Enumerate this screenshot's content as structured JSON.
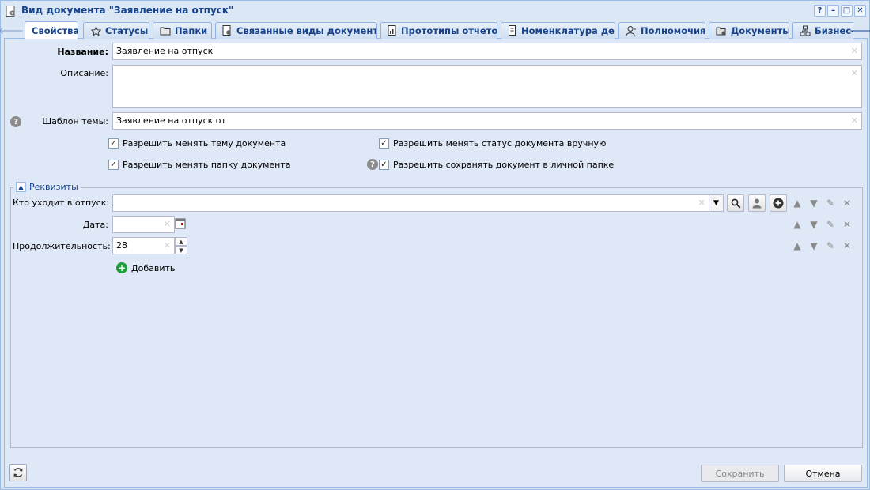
{
  "window": {
    "title": "Вид документа \"Заявление на отпуск\"",
    "buttons": {
      "help": "?",
      "minimize": "–",
      "maximize": "□",
      "close": "✕"
    }
  },
  "tabs": [
    {
      "label": "Свойства",
      "icon": "none",
      "active": true
    },
    {
      "label": "Статусы",
      "icon": "star-icon"
    },
    {
      "label": "Папки",
      "icon": "folder-icon"
    },
    {
      "label": "Связанные виды документов",
      "icon": "linked-doc-icon"
    },
    {
      "label": "Прототипы отчетов",
      "icon": "report-icon"
    },
    {
      "label": "Номенклатура дел",
      "icon": "nomenclature-icon"
    },
    {
      "label": "Полномочия",
      "icon": "user-permission-icon"
    },
    {
      "label": "Документы",
      "icon": "documents-icon"
    },
    {
      "label": "Бизнес-",
      "icon": "process-icon"
    }
  ],
  "form": {
    "name_label": "Название:",
    "name_value": "Заявление на отпуск",
    "description_label": "Описание:",
    "description_value": "",
    "template_label": "Шаблон темы:",
    "template_value": "Заявление на отпуск от",
    "help_glyph": "?"
  },
  "checkboxes": {
    "allow_change_subject": {
      "label": "Разрешить менять тему документа",
      "checked": true
    },
    "allow_change_folder": {
      "label": "Разрешить менять папку документа",
      "checked": true
    },
    "allow_change_status": {
      "label": "Разрешить менять статус документа вручную",
      "checked": true
    },
    "allow_save_personal": {
      "label": "Разрешить сохранять документ в личной папке",
      "checked": true
    },
    "check_glyph": "✓"
  },
  "requisites": {
    "legend": "Реквизиты",
    "rows": [
      {
        "label": "Кто уходит в отпуск:",
        "value": ""
      },
      {
        "label": "Дата:",
        "value": ""
      },
      {
        "label": "Продолжительность:",
        "value": "28"
      }
    ],
    "add_label": "Добавить"
  },
  "footer": {
    "save_label": "Сохранить",
    "cancel_label": "Отмена"
  },
  "colors": {
    "accent": "#15428b",
    "panel_bg": "#dfe8f6",
    "add_green": "#1f9d3a"
  }
}
